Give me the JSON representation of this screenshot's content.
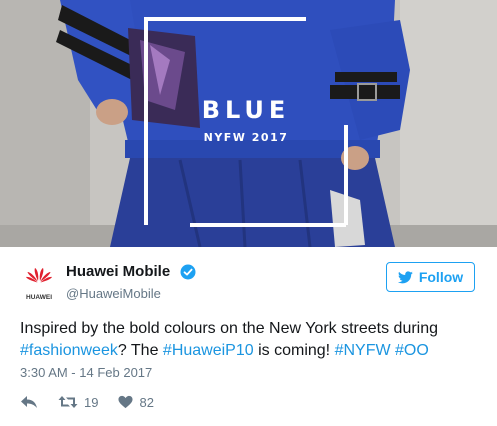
{
  "image": {
    "overlay_title": "BLUE",
    "overlay_subtitle": "NYFW 2017",
    "colors": {
      "sweater": "#2f4fbe",
      "skirt": "#2a3f98",
      "background": "#c6c4c0"
    }
  },
  "tweet": {
    "author_name": "Huawei Mobile",
    "author_handle": "@HuaweiMobile",
    "logo_text": "HUAWEI",
    "follow_label": "Follow",
    "text": {
      "part1": "Inspired by the bold colours on the New York streets during ",
      "hashtag1": "#fashionweek",
      "part2": "? The ",
      "hashtag2": "#HuaweiP10",
      "part3": " is coming! ",
      "hashtag3": "#NYFW",
      "part4": " ",
      "hashtag4": "#OO"
    },
    "timestamp": "3:30 AM - 14 Feb 2017",
    "retweet_count": "19",
    "like_count": "82"
  },
  "colors": {
    "link": "#1b95e0",
    "follow_blue": "#1da1f2",
    "huawei_red": "#e0202e",
    "muted": "#657786"
  },
  "icons": [
    "huawei-logo",
    "verified-badge-icon",
    "twitter-bird-icon",
    "reply-icon",
    "retweet-icon",
    "heart-icon"
  ]
}
